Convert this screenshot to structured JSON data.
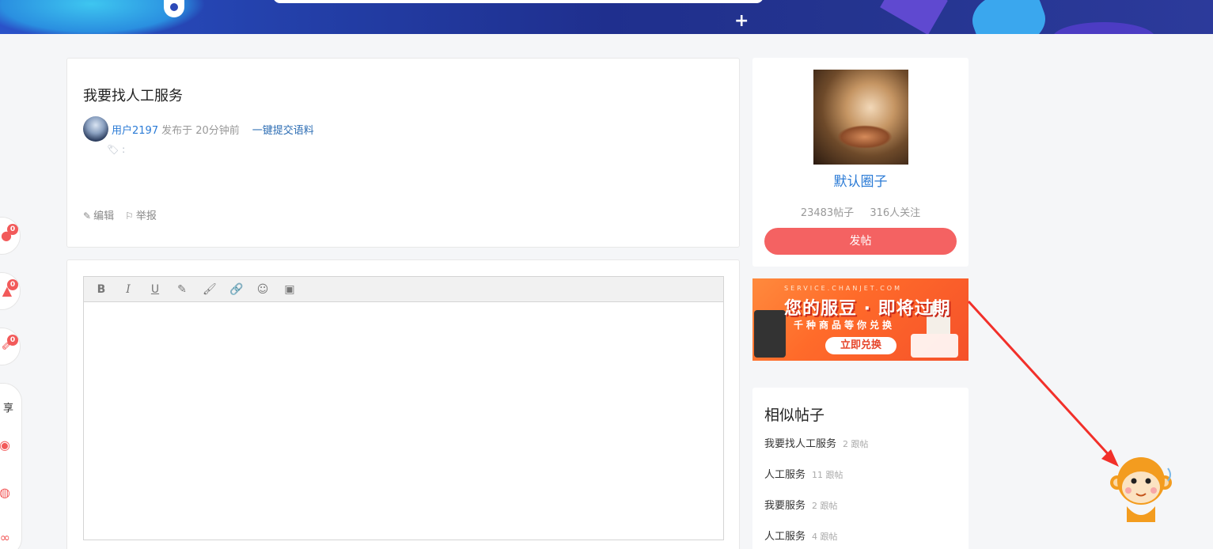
{
  "post": {
    "title": "我要找人工服务",
    "author": "用户2197",
    "meta": "发布于 20分钟前",
    "submit_link": "一键提交语料",
    "tags_sep": ":",
    "edit_label": "编辑",
    "report_label": "举报"
  },
  "float_tools": {
    "comment_count": "0",
    "like_count": "0",
    "favorite_count": "0",
    "share_label": "享"
  },
  "editor": {
    "toolbar": [
      "B",
      "I",
      "U",
      "✎",
      "🖌",
      "🔗",
      "☺",
      "▣"
    ]
  },
  "circle": {
    "name": "默认圈子",
    "posts": "23483帖子",
    "followers": "316人关注",
    "post_button": "发帖"
  },
  "ad": {
    "url": "SERVICE.CHANJET.COM",
    "headline": "您的服豆 · 即将过期",
    "subline": "千种商品等你兑换",
    "cta": "立即兑换"
  },
  "similar": {
    "title": "相似帖子",
    "items": [
      {
        "title": "我要找人工服务",
        "count": "2 跟帖"
      },
      {
        "title": "人工服务",
        "count": "11 跟帖"
      },
      {
        "title": "我要服务",
        "count": "2 跟帖"
      },
      {
        "title": "人工服务",
        "count": "4 跟帖"
      }
    ]
  },
  "colors": {
    "accent_red": "#f46262",
    "link_blue": "#2b7bd6",
    "annotation_arrow": "#f2302a"
  }
}
